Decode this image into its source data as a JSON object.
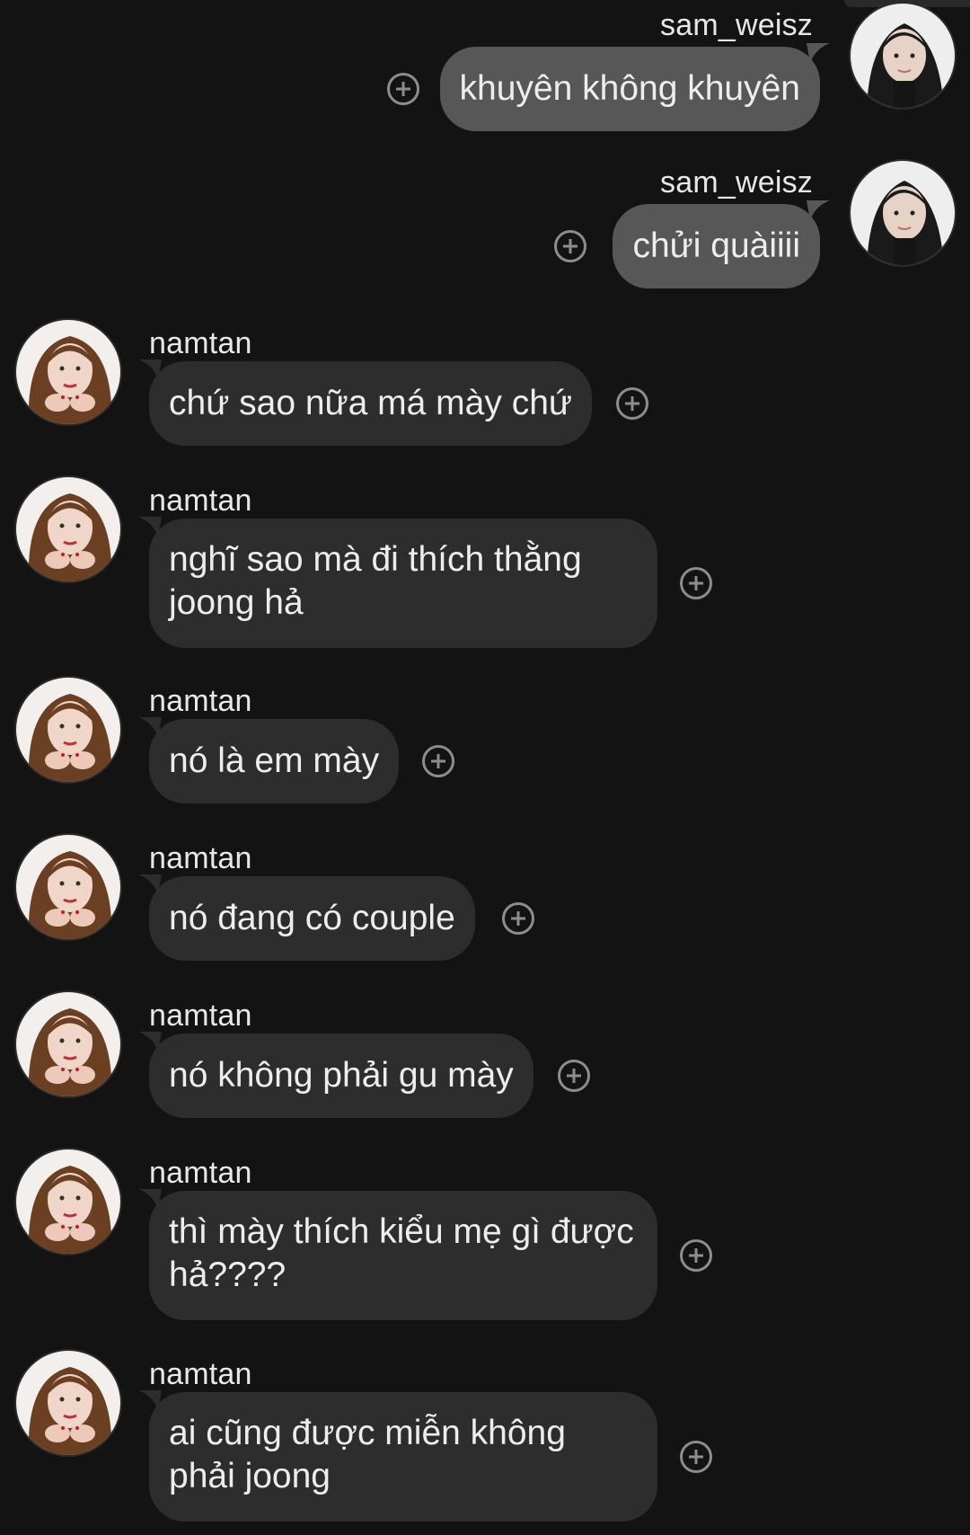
{
  "messages": [
    {
      "sender": "sam_weisz",
      "text": "khuyên không khuyên",
      "side": "right"
    },
    {
      "sender": "sam_weisz",
      "text": "chửi quàiiii",
      "side": "right"
    },
    {
      "sender": "namtan",
      "text": "chứ sao nữa má mày chứ",
      "side": "left"
    },
    {
      "sender": "namtan",
      "lines": [
        "nghĩ sao mà đi thích thằng",
        "joong hả"
      ],
      "side": "left"
    },
    {
      "sender": "namtan",
      "text": "nó là em mày",
      "side": "left"
    },
    {
      "sender": "namtan",
      "text": "nó đang có couple",
      "side": "left"
    },
    {
      "sender": "namtan",
      "text": "nó không phải gu mày",
      "side": "left"
    },
    {
      "sender": "namtan",
      "lines": [
        "thì mày thích kiểu mẹ gì được",
        "hả????"
      ],
      "side": "left"
    },
    {
      "sender": "namtan",
      "lines": [
        "ai cũng được miễn không",
        "phải joong"
      ],
      "side": "left"
    }
  ],
  "icons": {
    "reaction": "add-reaction-icon",
    "avatar_sam": "avatar-sam-weisz",
    "avatar_namtan": "avatar-namtan"
  },
  "colors": {
    "background": "#131313",
    "my_bubble": "#575757",
    "their_bubble": "#2d2d2d"
  }
}
